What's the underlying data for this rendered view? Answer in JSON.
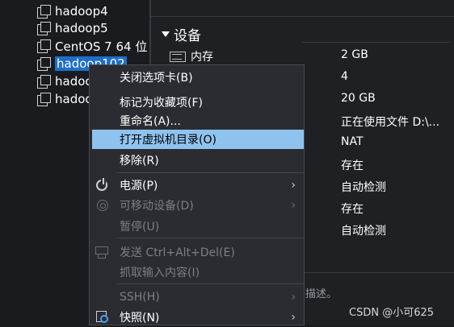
{
  "library": {
    "vms": [
      {
        "label": "hadoop4",
        "selected": false
      },
      {
        "label": "hadoop5",
        "selected": false
      },
      {
        "label": "CentOS 7 64 位",
        "selected": false
      },
      {
        "label": "hadoop102",
        "selected": true
      },
      {
        "label": "hadoo",
        "selected": false
      },
      {
        "label": "hadoo",
        "selected": false
      }
    ]
  },
  "details": {
    "section_title": "设备",
    "memory_label": "内存",
    "values": [
      "2 GB",
      "4",
      "20 GB",
      "正在使用文件 D:\\...",
      "NAT",
      "存在",
      "自动检测",
      "存在",
      "自动检测"
    ],
    "description_tail": "描述。"
  },
  "context_menu": {
    "items": [
      {
        "label": "关闭选项卡(B)",
        "disabled": false
      },
      {
        "label": "标记为收藏项(F)",
        "disabled": false
      },
      {
        "label": "重命名(A)...",
        "disabled": false
      },
      {
        "label": "打开虚拟机目录(O)",
        "disabled": false,
        "highlighted": true
      },
      {
        "label": "移除(R)",
        "disabled": false
      },
      {
        "label": "电源(P)",
        "disabled": false,
        "submenu": true,
        "icon": "power-icon"
      },
      {
        "label": "可移动设备(D)",
        "disabled": true,
        "submenu": true,
        "icon": "removable-device-icon"
      },
      {
        "label": "暂停(U)",
        "disabled": true
      },
      {
        "label": "发送 Ctrl+Alt+Del(E)",
        "disabled": true,
        "icon": "send-keys-icon"
      },
      {
        "label": "抓取输入内容(I)",
        "disabled": true
      },
      {
        "label": "SSH(H)",
        "disabled": true,
        "submenu": true
      },
      {
        "label": "快照(N)",
        "disabled": false,
        "submenu": true,
        "icon": "snapshot-icon"
      }
    ],
    "submenu_arrow": "›"
  },
  "watermark": "CSDN @小可625",
  "colors": {
    "selection": "#1e6fc9",
    "menu_highlight": "#8fc3ef",
    "menu_bg": "#2b2c31"
  }
}
